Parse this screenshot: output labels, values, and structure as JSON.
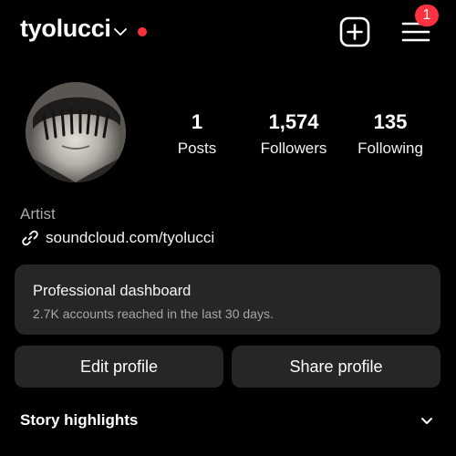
{
  "header": {
    "username": "tyolucci",
    "notification_count": "1"
  },
  "profile": {
    "stats": [
      {
        "value": "1",
        "label": "Posts"
      },
      {
        "value": "1,574",
        "label": "Followers"
      },
      {
        "value": "135",
        "label": "Following"
      }
    ],
    "category": "Artist",
    "link": "soundcloud.com/tyolucci"
  },
  "dashboard": {
    "title": "Professional dashboard",
    "subtitle": "2.7K accounts reached in the last 30 days."
  },
  "actions": {
    "edit_label": "Edit profile",
    "share_label": "Share profile"
  },
  "highlights": {
    "title": "Story highlights"
  },
  "icons": {
    "account_switch": "chevron-down-icon",
    "live_indicator": "red-dot-icon",
    "create": "plus-square-icon",
    "menu": "hamburger-menu-icon",
    "link": "link-icon",
    "highlights_toggle": "chevron-down-icon"
  },
  "colors": {
    "background": "#000000",
    "card": "#262626",
    "accent_red": "#ff3040",
    "muted_text": "#a8a8a8"
  }
}
